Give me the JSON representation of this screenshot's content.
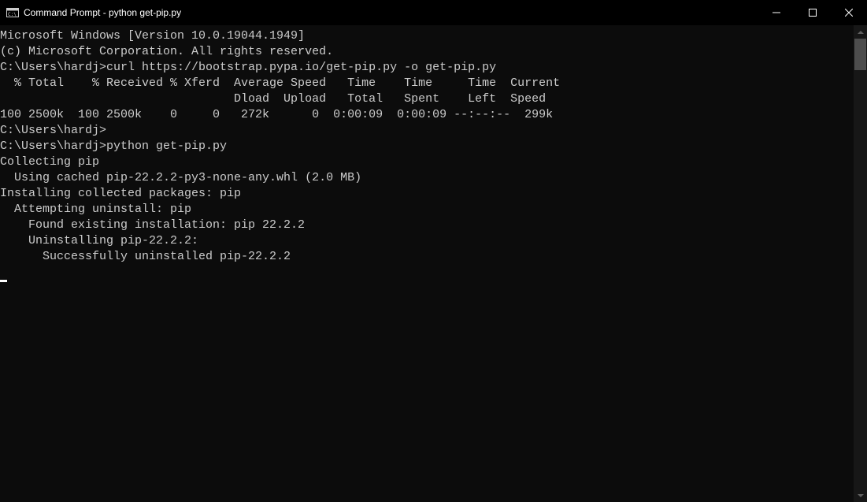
{
  "window": {
    "title": "Command Prompt - python  get-pip.py"
  },
  "terminal": {
    "lines": [
      "Microsoft Windows [Version 10.0.19044.1949]",
      "(c) Microsoft Corporation. All rights reserved.",
      "",
      "C:\\Users\\hardj>curl https://bootstrap.pypa.io/get-pip.py -o get-pip.py",
      "  % Total    % Received % Xferd  Average Speed   Time    Time     Time  Current",
      "                                 Dload  Upload   Total   Spent    Left  Speed",
      "100 2500k  100 2500k    0     0   272k      0  0:00:09  0:00:09 --:--:--  299k",
      "",
      "C:\\Users\\hardj>",
      "",
      "C:\\Users\\hardj>python get-pip.py",
      "Collecting pip",
      "  Using cached pip-22.2.2-py3-none-any.whl (2.0 MB)",
      "Installing collected packages: pip",
      "  Attempting uninstall: pip",
      "    Found existing installation: pip 22.2.2",
      "    Uninstalling pip-22.2.2:",
      "      Successfully uninstalled pip-22.2.2"
    ]
  }
}
